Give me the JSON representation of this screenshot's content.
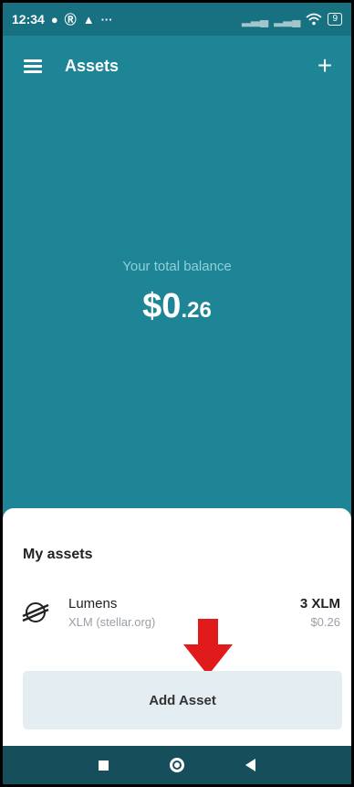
{
  "status_bar": {
    "time": "12:34",
    "icons": [
      "water-drop-icon",
      "data-saver-icon",
      "warning-icon",
      "more-dots-icon"
    ],
    "right_icons": [
      "signal-icon",
      "signal-icon",
      "wifi-icon",
      "battery-icon"
    ],
    "battery_level": "9"
  },
  "app_bar": {
    "title": "Assets",
    "menu_icon": "hamburger-menu-icon",
    "add_icon": "plus-icon",
    "add_label": "+"
  },
  "balance": {
    "label": "Your total balance",
    "whole": "$0",
    "cents": ".26"
  },
  "assets_section": {
    "title": "My assets",
    "items": [
      {
        "name": "Lumens",
        "subtitle": "XLM (stellar.org)",
        "amount": "3 XLM",
        "usd_value": "$0.26",
        "icon": "stellar-logo-icon"
      }
    ],
    "add_button_label": "Add Asset",
    "annotation_icon": "red-down-arrow-icon"
  },
  "nav_bar": {
    "buttons": [
      "recents-square-icon",
      "home-circle-icon",
      "back-triangle-icon"
    ]
  },
  "colors": {
    "primary": "#1d8596",
    "status_bar": "#177180",
    "nav_bar": "#174e5c",
    "button_bg": "#e4edf1",
    "arrow": "#e11b1b"
  }
}
